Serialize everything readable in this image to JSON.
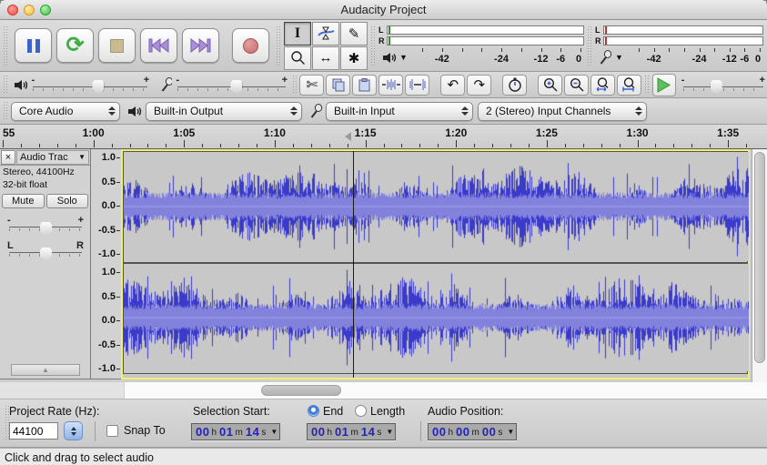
{
  "window": {
    "title": "Audacity Project"
  },
  "icons": {
    "loop_play": "⟳",
    "pencil": "✎",
    "time_shift": "↔",
    "multi_tool": "✱",
    "selection_tool": "I",
    "scissors": "✄",
    "undo": "↶",
    "redo": "↷",
    "dropdown": "▼",
    "collapse_up": "▲"
  },
  "meters": {
    "playback": {
      "left": "L",
      "right": "R",
      "scale": [
        "-42",
        "-24",
        "-12",
        "-6",
        "0"
      ]
    },
    "recording": {
      "left": "L",
      "right": "R",
      "scale": [
        "-42",
        "-24",
        "-12",
        "-6",
        "0"
      ]
    }
  },
  "mixer": {
    "minus": "-",
    "plus": "+"
  },
  "speed": {
    "minus": "-",
    "plus": "+"
  },
  "device": {
    "host": "Core Audio",
    "output": "Built-in Output",
    "input": "Built-in Input",
    "channels": "2 (Stereo) Input Channels"
  },
  "timeline": {
    "ticks": [
      {
        "sec": 55,
        "label": "55"
      },
      {
        "sec": 60,
        "label": "1:00"
      },
      {
        "sec": 65,
        "label": "1:05"
      },
      {
        "sec": 70,
        "label": "1:10"
      },
      {
        "sec": 75,
        "label": "1:15"
      },
      {
        "sec": 80,
        "label": "1:20"
      },
      {
        "sec": 85,
        "label": "1:25"
      },
      {
        "sec": 90,
        "label": "1:30"
      },
      {
        "sec": 95,
        "label": "1:35"
      }
    ],
    "cursor_sec": 74.2
  },
  "track": {
    "close": "×",
    "title": "Audio Trac",
    "line1": "Stereo, 44100Hz",
    "line2": "32-bit float",
    "mute": "Mute",
    "solo": "Solo",
    "gain_minus": "-",
    "gain_plus": "+",
    "pan_left": "L",
    "pan_right": "R",
    "ruler_values": [
      "1.0",
      "0.5",
      "0.0",
      "-0.5",
      "-1.0"
    ]
  },
  "selection_bar": {
    "rate_label": "Project Rate (Hz):",
    "rate": "44100",
    "snap": "Snap To",
    "sel_start_label": "Selection Start:",
    "end": "End",
    "length": "Length",
    "audio_pos_label": "Audio Position:",
    "uh": "h",
    "um": "m",
    "us": "s",
    "start": {
      "h": "00",
      "m": "01",
      "s": "14"
    },
    "end_time": {
      "h": "00",
      "m": "01",
      "s": "14"
    },
    "audio": {
      "h": "00",
      "m": "00",
      "s": "00"
    }
  },
  "status": {
    "text": "Click and drag to select audio"
  },
  "colors": {
    "wave_peak": "#3a3acc",
    "wave_rms": "#8282dd",
    "wave_bg": "#c8c8c8",
    "focus_border": "#efef70",
    "meter_play_tick": "#2e8b2e",
    "meter_rec_tick": "#c03030"
  }
}
